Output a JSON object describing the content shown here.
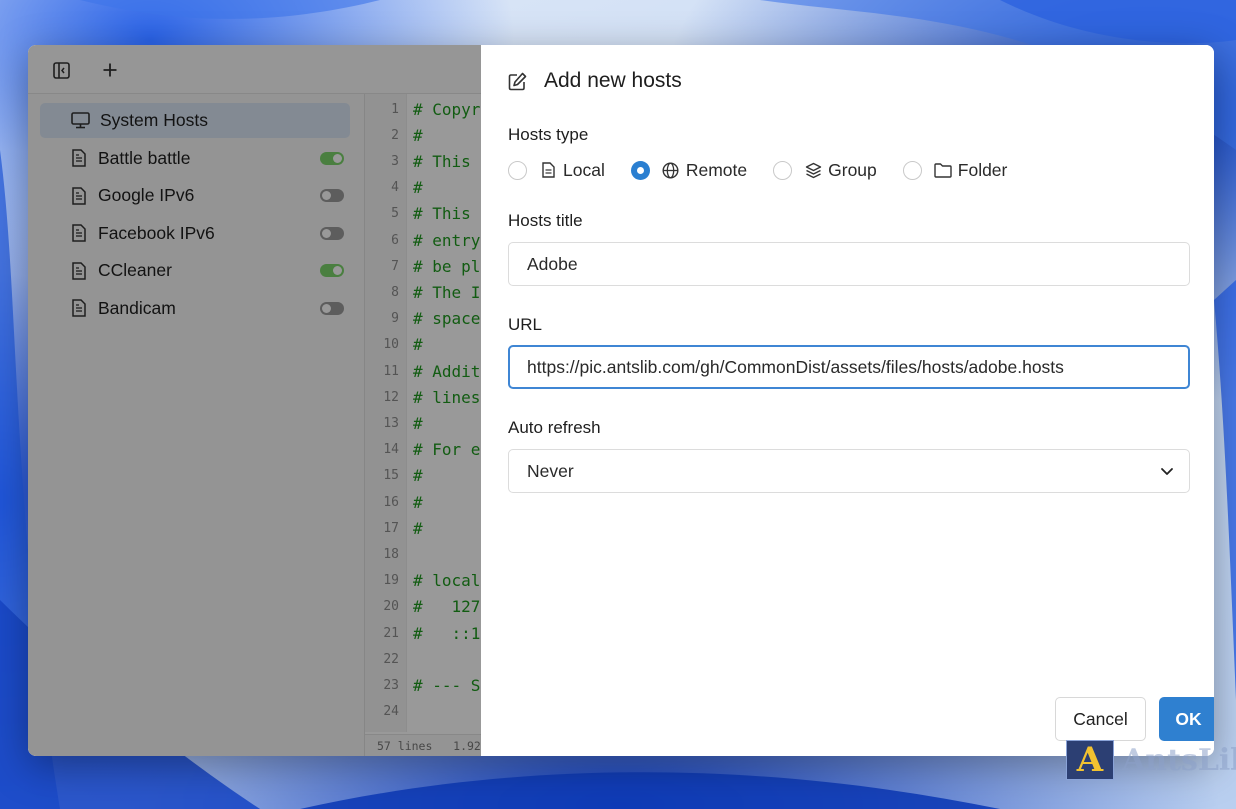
{
  "toolbar": {
    "toggle_sidebar_icon": "sidebar-toggle-icon",
    "add_icon": "plus-icon"
  },
  "sidebar": {
    "items": [
      {
        "label": "System Hosts",
        "icon": "monitor-icon",
        "active": true
      },
      {
        "label": "Battle battle",
        "icon": "file-icon",
        "enabled": true
      },
      {
        "label": "Google IPv6",
        "icon": "file-icon",
        "enabled": false
      },
      {
        "label": "Facebook IPv6",
        "icon": "file-icon",
        "enabled": false
      },
      {
        "label": "CCleaner",
        "icon": "file-icon",
        "enabled": true
      },
      {
        "label": "Bandicam",
        "icon": "file-icon",
        "enabled": false
      }
    ]
  },
  "editor": {
    "lines": [
      {
        "n": "1",
        "text": "# Copyr"
      },
      {
        "n": "2",
        "text": "#"
      },
      {
        "n": "3",
        "text": "# This "
      },
      {
        "n": "4",
        "text": "#"
      },
      {
        "n": "5",
        "text": "# This "
      },
      {
        "n": "6",
        "text": "# entry"
      },
      {
        "n": "7",
        "text": "# be pl"
      },
      {
        "n": "8",
        "text": "# The I"
      },
      {
        "n": "9",
        "text": "# space"
      },
      {
        "n": "10",
        "text": "#"
      },
      {
        "n": "11",
        "text": "# Addit"
      },
      {
        "n": "12",
        "text": "# lines"
      },
      {
        "n": "13",
        "text": "#"
      },
      {
        "n": "14",
        "text": "# For e"
      },
      {
        "n": "15",
        "text": "#"
      },
      {
        "n": "16",
        "text": "#"
      },
      {
        "n": "17",
        "text": "#"
      },
      {
        "n": "18",
        "text": ""
      },
      {
        "n": "19",
        "text": "# local"
      },
      {
        "n": "20",
        "text": "#   127"
      },
      {
        "n": "21",
        "text": "#   ::1"
      },
      {
        "n": "22",
        "text": ""
      },
      {
        "n": "23",
        "text": "# --- S"
      },
      {
        "n": "24",
        "text": ""
      }
    ],
    "status": "57 lines   1.92"
  },
  "modal": {
    "title": "Add new hosts",
    "title_icon": "edit-icon",
    "hosts_type_label": "Hosts type",
    "hosts_types": [
      {
        "label": "Local",
        "icon": "file-icon",
        "checked": false
      },
      {
        "label": "Remote",
        "icon": "globe-icon",
        "checked": true
      },
      {
        "label": "Group",
        "icon": "layers-icon",
        "checked": false
      },
      {
        "label": "Folder",
        "icon": "folder-icon",
        "checked": false
      }
    ],
    "hosts_title_label": "Hosts title",
    "hosts_title_value": "Adobe",
    "url_label": "URL",
    "url_value": "https://pic.antslib.com/gh/CommonDist/assets/files/hosts/adobe.hosts",
    "auto_refresh_label": "Auto refresh",
    "auto_refresh_value": "Never",
    "cancel_label": "Cancel",
    "ok_label": "OK"
  },
  "watermark": {
    "logo_letter": "A",
    "text": "AntsLib"
  },
  "colors": {
    "accent": "#2f80d0",
    "toggle_on": "#7cd46b",
    "toggle_off": "#9b9b9b",
    "code_comment": "#1f9a1f"
  }
}
